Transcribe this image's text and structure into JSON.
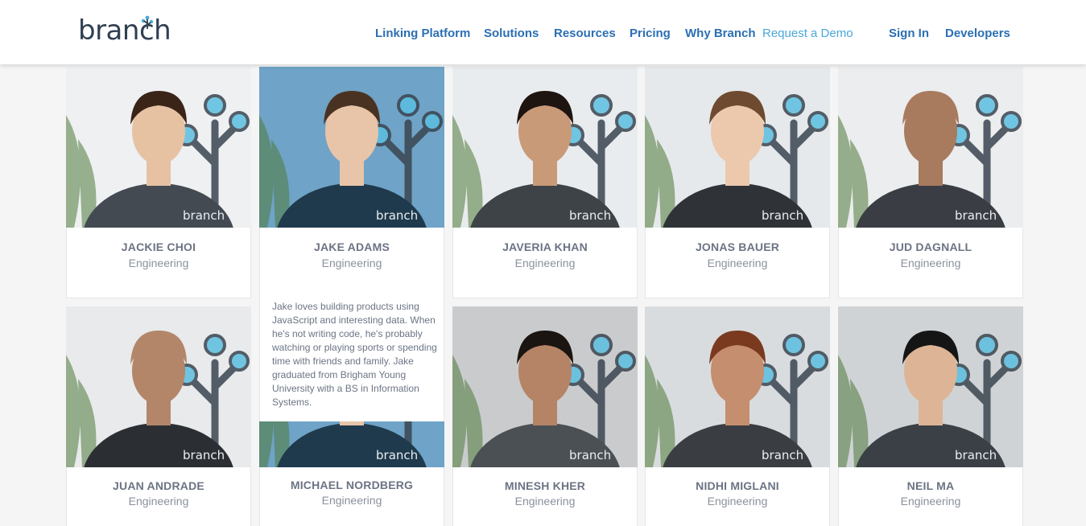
{
  "header": {
    "logo_text": "branch",
    "nav": {
      "linking_platform": "Linking Platform",
      "solutions": "Solutions",
      "resources": "Resources",
      "pricing": "Pricing",
      "why_branch": "Why Branch",
      "request_demo": "Request a Demo",
      "sign_in": "Sign In",
      "developers": "Developers"
    }
  },
  "team": [
    {
      "name": "JACKIE CHOI",
      "role": "Engineering",
      "shirt": "#444a52",
      "skin": "#e6c2a3",
      "hair": "#3a2418",
      "bg": "#eef0f2"
    },
    {
      "name": "JAKE ADAMS",
      "role": "Engineering",
      "shirt": "#1f3a4d",
      "skin": "#e8c4a8",
      "hair": "#4a3222",
      "bg": "#6fa3c7"
    },
    {
      "name": "JAVERIA KHAN",
      "role": "Engineering",
      "shirt": "#3e4348",
      "skin": "#c99a78",
      "hair": "#1e1410",
      "bg": "#e9ecee"
    },
    {
      "name": "JONAS BAUER",
      "role": "Engineering",
      "shirt": "#2f3338",
      "skin": "#ecc8ad",
      "hair": "#6e4a30",
      "bg": "#e6e9eb"
    },
    {
      "name": "JUD DAGNALL",
      "role": "Engineering",
      "shirt": "#3a3e44",
      "skin": "#a87a5e",
      "hair": "#a87a5e",
      "bg": "#ebedee"
    },
    {
      "name": "JUAN ANDRADE",
      "role": "Engineering",
      "shirt": "#2b2f34",
      "skin": "#b3866a",
      "hair": "#b3866a",
      "bg": "#e8eaec"
    },
    {
      "name": "MICHAEL NORDBERG",
      "role": "Engineering",
      "shirt": "#1f3a4d",
      "skin": "#e8c4a8",
      "hair": "#4a3222",
      "bg": "#6fa3c7"
    },
    {
      "name": "MINESH KHER",
      "role": "Engineering",
      "shirt": "#4a5054",
      "skin": "#b58466",
      "hair": "#1b1512",
      "bg": "#c9cbcd"
    },
    {
      "name": "NIDHI MIGLANI",
      "role": "Engineering",
      "shirt": "#3a3d42",
      "skin": "#c58e6e",
      "hair": "#7a3a20",
      "bg": "#d9dcde"
    },
    {
      "name": "NEIL MA",
      "role": "Engineering",
      "shirt": "#3a4046",
      "skin": "#ddb596",
      "hair": "#151515",
      "bg": "#d0d3d6"
    }
  ],
  "hover_bio": "Jake loves building products using JavaScript and interesting data. When he's not writing code, he's probably watching or playing sports or spending time with friends and family. Jake graduated from Brigham Young University with a BS in Information Systems.",
  "shirt_logo": "branch",
  "colors": {
    "nav": "#2b6fb3",
    "demo": "#4aa8d8",
    "logo": "#2f3f52",
    "accent_teal": "#5bbfe0"
  }
}
